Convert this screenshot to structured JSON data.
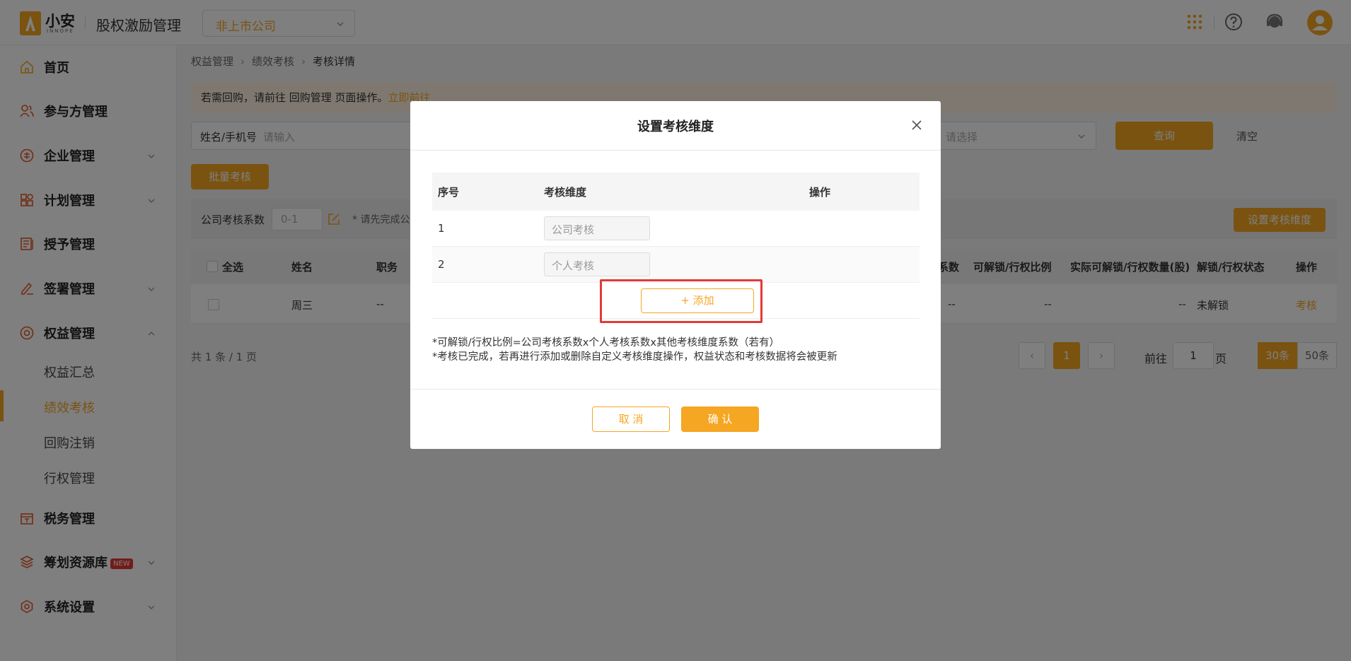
{
  "header": {
    "logo_text": "小安",
    "logo_sub": "INNOPE",
    "app_title": "股权激励管理",
    "company_select": "非上市公司"
  },
  "sidebar": {
    "items": [
      {
        "label": "首页",
        "icon": "home-icon"
      },
      {
        "label": "参与方管理",
        "icon": "users-icon"
      },
      {
        "label": "企业管理",
        "icon": "enterprise-icon"
      },
      {
        "label": "计划管理",
        "icon": "grid-icon"
      },
      {
        "label": "授予管理",
        "icon": "doc-icon"
      },
      {
        "label": "签署管理",
        "icon": "sign-icon"
      },
      {
        "label": "权益管理",
        "icon": "equity-icon"
      },
      {
        "label": "税务管理",
        "icon": "tax-icon"
      },
      {
        "label": "筹划资源库",
        "icon": "layers-icon"
      },
      {
        "label": "系统设置",
        "icon": "settings-icon"
      }
    ],
    "equity_sub": [
      "权益汇总",
      "绩效考核",
      "回购注销",
      "行权管理"
    ],
    "new_badge": "NEW"
  },
  "breadcrumb": [
    "权益管理",
    "绩效考核",
    "考核详情"
  ],
  "banner": {
    "text": "若需回购，请前往 回购管理 页面操作。",
    "link": "立即前往"
  },
  "filters": {
    "name_label": "姓名/手机号",
    "name_placeholder": "请输入",
    "status_placeholder": "请选择",
    "query": "查询",
    "clear": "清空"
  },
  "batch_button": "批量考核",
  "coef": {
    "label": "公司考核系数",
    "placeholder": "0-1",
    "note": "* 请先完成公",
    "set_dim_button": "设置考核维度"
  },
  "table": {
    "select_all": "全选",
    "headers": [
      "姓名",
      "职务",
      "系数",
      "可解锁/行权比例",
      "实际可解锁/行权数量(股)",
      "解锁/行权状态",
      "操作"
    ],
    "row": {
      "name": "周三",
      "position": "--",
      "coef": "--",
      "ratio": "--",
      "qty": "--",
      "status": "未解锁",
      "action": "考核"
    }
  },
  "pagination": {
    "total": "共 1 条 / 1 页",
    "current": "1",
    "goto_label": "前往",
    "goto_value": "1",
    "goto_unit": "页",
    "sizes": [
      "30条",
      "50条"
    ]
  },
  "modal": {
    "title": "设置考核维度",
    "headers": [
      "序号",
      "考核维度",
      "操作"
    ],
    "rows": [
      {
        "no": "1",
        "placeholder": "公司考核"
      },
      {
        "no": "2",
        "placeholder": "个人考核"
      }
    ],
    "add_button": "+ 添加",
    "notes": [
      "*可解锁/行权比例=公司考核系数x个人考核系数x其他考核维度系数（若有）",
      "*考核已完成，若再进行添加或删除自定义考核维度操作，权益状态和考核数据将会被更新"
    ],
    "cancel": "取 消",
    "confirm": "确 认"
  },
  "colors": {
    "accent": "#f5a623",
    "highlight": "#e53935"
  }
}
